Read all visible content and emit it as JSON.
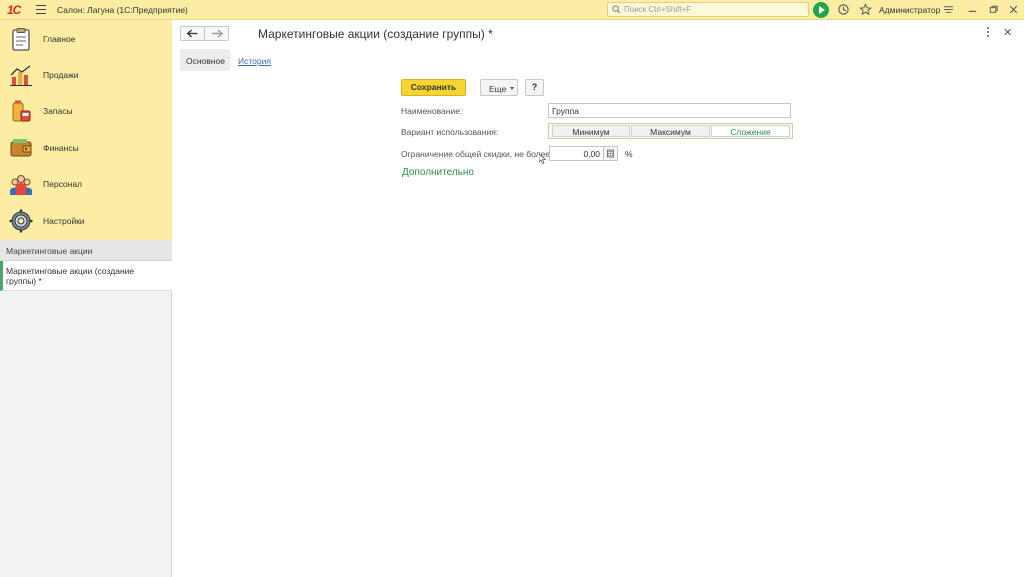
{
  "app": {
    "logo": "1С",
    "title": "Салон: Лагуна  (1С:Предприятие)",
    "search_placeholder": "Поиск Ctrl+Shift+F",
    "user": "Администратор"
  },
  "sidebar": {
    "sections": [
      {
        "label": "Главное",
        "icon": "clipboard-icon"
      },
      {
        "label": "Продажи",
        "icon": "sales-chart-icon"
      },
      {
        "label": "Запасы",
        "icon": "stock-icon"
      },
      {
        "label": "Финансы",
        "icon": "wallet-icon"
      },
      {
        "label": "Персонал",
        "icon": "people-icon"
      },
      {
        "label": "Настройки",
        "icon": "gear-icon"
      }
    ],
    "open_windows_header": "Маркетинговые акции",
    "open_window": "Маркетинговые акции (создание группы) *"
  },
  "form": {
    "title": "Маркетинговые акции (создание группы) *",
    "tabs": {
      "main": "Основное",
      "history": "История"
    },
    "buttons": {
      "save": "Сохранить",
      "more": "Еще",
      "help": "?"
    },
    "fields": {
      "name_label": "Наименование:",
      "name_value": "Группа",
      "variant_label": "Вариант использования:",
      "variant_options": [
        "Минимум",
        "Максимум",
        "Сложение"
      ],
      "variant_selected": "Сложение",
      "discount_label": "Ограничение общей скидки, не более:",
      "discount_value": "0,00",
      "discount_unit": "%"
    },
    "extra_link": "Дополнительно"
  },
  "colors": {
    "topbar": "#fbeda3",
    "accent_green": "#2e8b4f",
    "save_button": "#f6d531"
  }
}
